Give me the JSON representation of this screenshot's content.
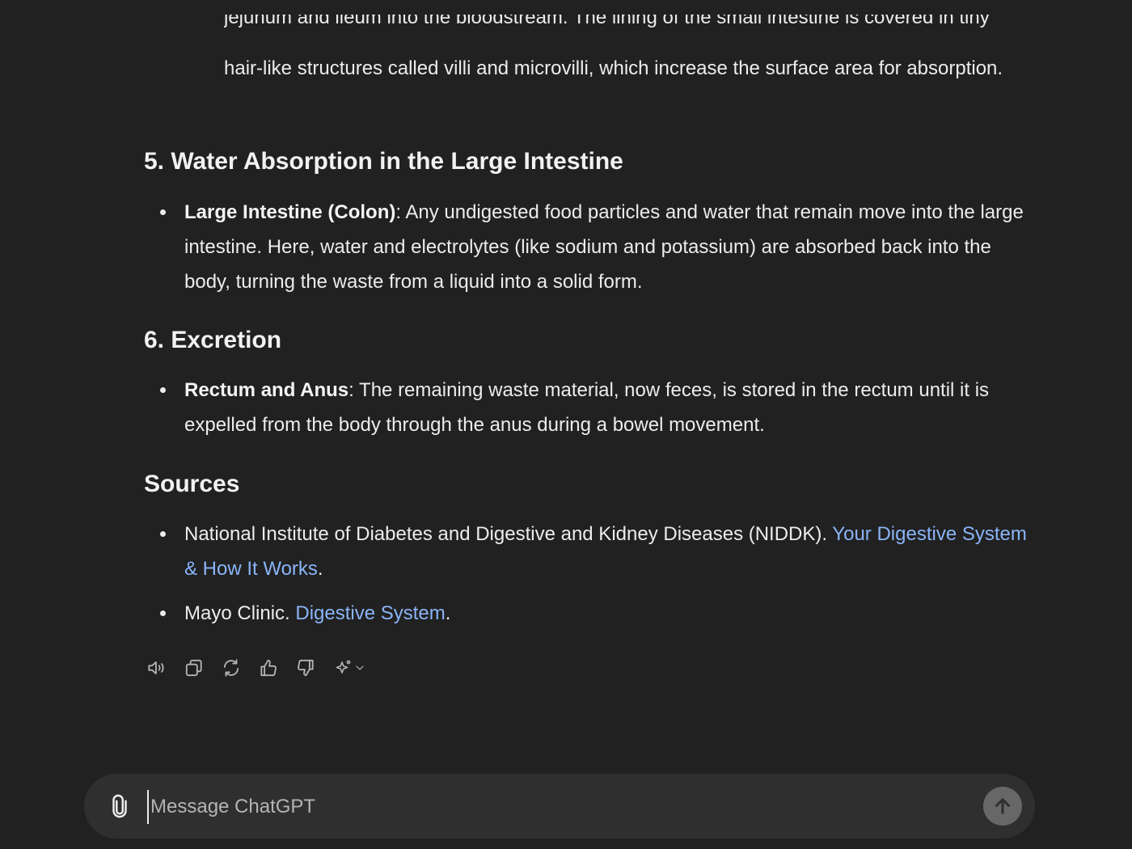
{
  "intro": {
    "cutoff_line": "jejunum and ileum into the bloodstream. The lining of the small intestine is covered in tiny",
    "continuation": "hair-like structures called villi and microvilli, which increase the surface area for absorption."
  },
  "sections": [
    {
      "heading": "5. Water Absorption in the Large Intestine",
      "bullets": [
        {
          "term": "Large Intestine (Colon)",
          "text": ": Any undigested food particles and water that remain move into the large intestine. Here, water and electrolytes (like sodium and potassium) are absorbed back into the body, turning the waste from a liquid into a solid form."
        }
      ]
    },
    {
      "heading": "6. Excretion",
      "bullets": [
        {
          "term": "Rectum and Anus",
          "text": ": The remaining waste material, now feces, is stored in the rectum until it is expelled from the body through the anus during a bowel movement."
        }
      ]
    }
  ],
  "sources": {
    "heading": "Sources",
    "items": [
      {
        "prefix": "National Institute of Diabetes and Digestive and Kidney Diseases (NIDDK). ",
        "link_text": "Your Digestive System & How It Works",
        "suffix": "."
      },
      {
        "prefix": "Mayo Clinic. ",
        "link_text": "Digestive System",
        "suffix": "."
      }
    ]
  },
  "actions": [
    "speaker-icon",
    "copy-icon",
    "regenerate-icon",
    "thumbs-up-icon",
    "thumbs-down-icon",
    "sparkle-icon"
  ],
  "composer": {
    "placeholder": "Message ChatGPT",
    "value": ""
  },
  "colors": {
    "background": "#212121",
    "composer_bg": "#2f2f2f",
    "link": "#8ab4f8",
    "send_button": "#676767"
  }
}
